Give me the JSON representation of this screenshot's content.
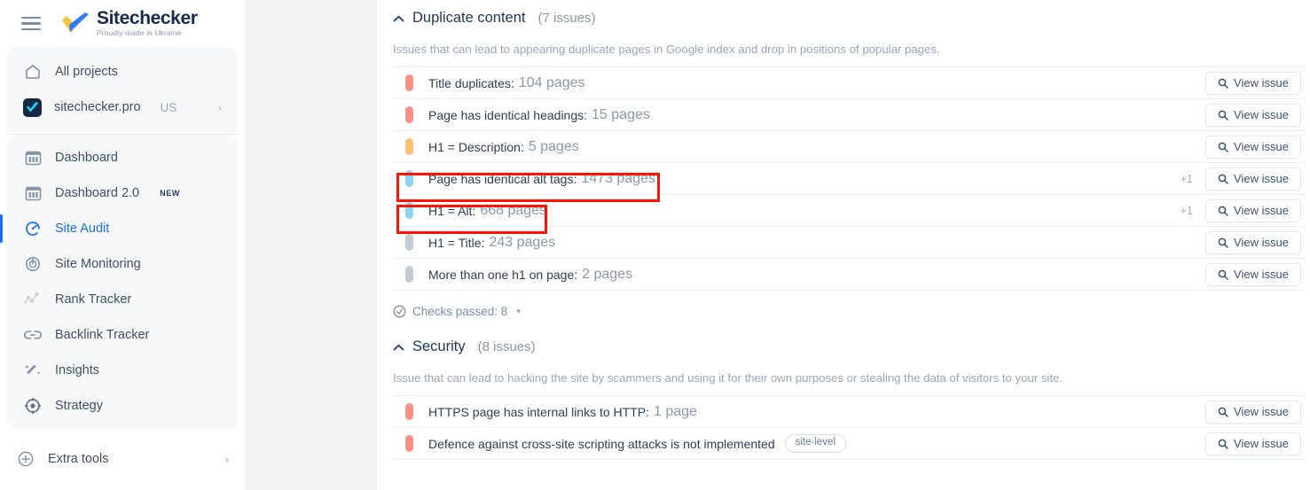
{
  "brand": {
    "name": "Sitechecker",
    "tagline": "Proudly made in Ukraine",
    "menu_icon": "hamburger-icon",
    "logo_icon": "checkmark-logo-icon"
  },
  "sidebar": {
    "top_items": [
      {
        "label": "All projects",
        "icon": "home-icon"
      }
    ],
    "project": {
      "label": "sitechecker.pro",
      "locale": "US",
      "chevron": "›",
      "icon": "project-favicon"
    },
    "nav_items": [
      {
        "label": "Dashboard",
        "icon": "dashboard-icon",
        "active": false,
        "badge": ""
      },
      {
        "label": "Dashboard 2.0",
        "icon": "dashboard-icon",
        "active": false,
        "badge": "NEW"
      },
      {
        "label": "Site Audit",
        "icon": "site-audit-icon",
        "active": true,
        "badge": ""
      },
      {
        "label": "Site Monitoring",
        "icon": "site-monitoring-icon",
        "active": false,
        "badge": ""
      },
      {
        "label": "Rank Tracker",
        "icon": "rank-tracker-icon",
        "active": false,
        "badge": ""
      },
      {
        "label": "Backlink Tracker",
        "icon": "backlink-icon",
        "active": false,
        "badge": ""
      },
      {
        "label": "Insights",
        "icon": "insights-wand-icon",
        "active": false,
        "badge": ""
      },
      {
        "label": "Strategy",
        "icon": "strategy-target-icon",
        "active": false,
        "badge": ""
      }
    ],
    "extra": {
      "label": "Extra tools",
      "icon": "plus-circle-icon",
      "chevron": "›"
    }
  },
  "main": {
    "sections": [
      {
        "title": "Duplicate content",
        "count": "(7 issues)",
        "collapse_icon": "chevron-up-icon",
        "description": "Issues that can lead to appearing duplicate pages in Google index and drop in positions of popular pages.",
        "issues": [
          {
            "name": "Title duplicates:",
            "count": "104 pages",
            "severity": "critical",
            "plus": "",
            "tag": "",
            "action": "View issue",
            "highlight": false
          },
          {
            "name": "Page has identical headings:",
            "count": "15 pages",
            "severity": "critical",
            "plus": "",
            "tag": "",
            "action": "View issue",
            "highlight": false
          },
          {
            "name": "H1 = Description:",
            "count": "5 pages",
            "severity": "warning",
            "plus": "",
            "tag": "",
            "action": "View issue",
            "highlight": false
          },
          {
            "name": "Page has identical alt tags:",
            "count": "1473 pages",
            "severity": "info",
            "plus": "+1",
            "tag": "",
            "action": "View issue",
            "highlight": true
          },
          {
            "name": "H1 = Alt:",
            "count": "668 pages",
            "severity": "info",
            "plus": "+1",
            "tag": "",
            "action": "View issue",
            "highlight": true
          },
          {
            "name": "H1 = Title:",
            "count": "243 pages",
            "severity": "notice",
            "plus": "",
            "tag": "",
            "action": "View issue",
            "highlight": false
          },
          {
            "name": "More than one h1 on page:",
            "count": "2 pages",
            "severity": "notice",
            "plus": "",
            "tag": "",
            "action": "View issue",
            "highlight": false
          }
        ],
        "checks_passed": {
          "label": "Checks passed: 8",
          "icon": "circle-check-icon",
          "caret": "▾"
        }
      },
      {
        "title": "Security",
        "count": "(8 issues)",
        "collapse_icon": "chevron-up-icon",
        "description": "Issue that can lead to hacking the site by scammers and using it for their own purposes or stealing the data of visitors to your site.",
        "issues": [
          {
            "name": "HTTPS page has internal links to HTTP:",
            "count": "1 page",
            "severity": "critical",
            "plus": "",
            "tag": "",
            "action": "View issue",
            "highlight": false
          },
          {
            "name": "Defence against cross-site scripting attacks is not implemented",
            "count": "",
            "severity": "critical",
            "plus": "",
            "tag": "site-level",
            "action": "View issue",
            "highlight": false
          }
        ],
        "checks_passed": null
      }
    ],
    "search_icon": "search-icon"
  },
  "colors": {
    "accent": "#1b6ef3",
    "critical": "#f99087",
    "warning": "#fbc173",
    "info": "#8ed4f2",
    "notice": "#c3cbd6",
    "highlight": "#ff1200"
  }
}
